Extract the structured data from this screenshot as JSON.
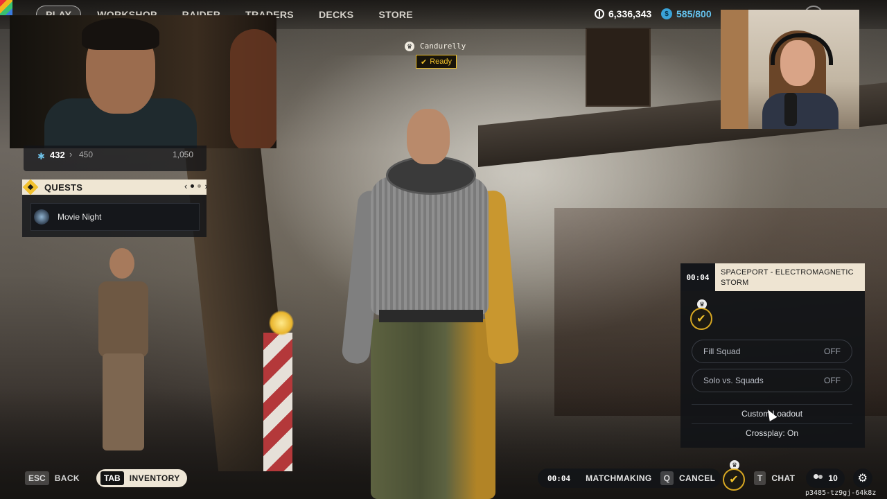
{
  "nav": {
    "items": [
      "PLAY",
      "WORKSHOP",
      "RAIDER",
      "TRADERS",
      "DECKS",
      "STORE"
    ],
    "active": "PLAY"
  },
  "currency": {
    "coins": "6,336,343",
    "credits": "585/800",
    "coin_icon": "coin-icon",
    "credit_icon": "credit-icon"
  },
  "level": {
    "current": "432",
    "next": "450",
    "max": "1,050"
  },
  "quests": {
    "title": "QUESTS",
    "items": [
      {
        "name": "Movie Night"
      }
    ]
  },
  "party": {
    "member_name": "Candurelly",
    "status": "Ready"
  },
  "matchmaking": {
    "timer": "00:04",
    "map_name": "SPACEPORT - ELECTROMAGNETIC STORM",
    "options": [
      {
        "label": "Fill Squad",
        "state": "OFF"
      },
      {
        "label": "Solo vs. Squads",
        "state": "OFF"
      }
    ],
    "custom_loadout": "Custom Loadout",
    "crossplay": "Crossplay: On"
  },
  "bottom": {
    "back_key": "ESC",
    "back_label": "BACK",
    "inventory_key": "TAB",
    "inventory_label": "INVENTORY",
    "mm_timer": "00:04",
    "mm_label": "MATCHMAKING",
    "cancel_key": "Q",
    "cancel_label": "CANCEL",
    "chat_key": "T",
    "chat_label": "CHAT",
    "friends_count": "10"
  },
  "session_id": "p3485-tz9gj-64k8z",
  "colors": {
    "accent_gold": "#f0c12b",
    "credit_blue": "#65c3ee",
    "panel_cream": "#eee4d2"
  }
}
